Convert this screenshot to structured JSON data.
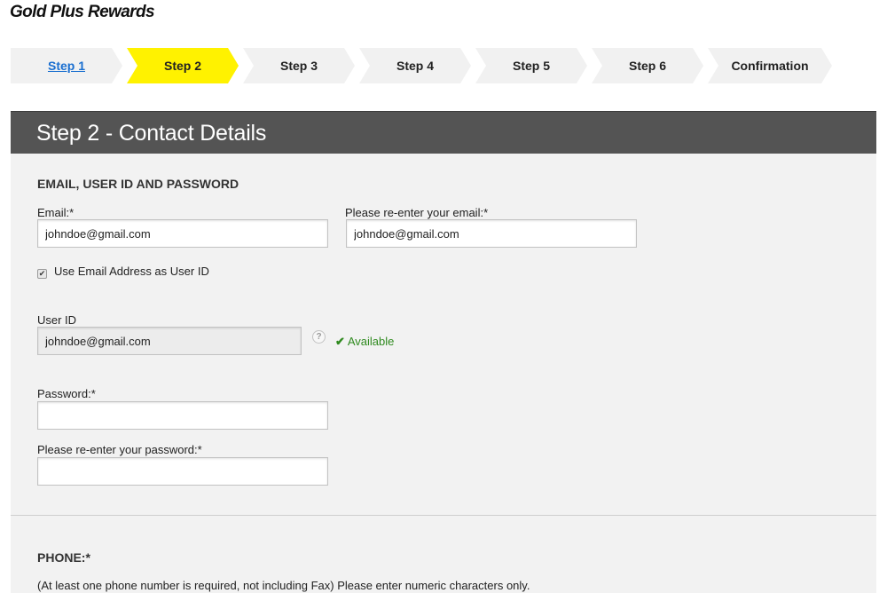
{
  "brand": {
    "title": "Gold Plus Rewards"
  },
  "steps": [
    {
      "label": "Step 1",
      "state": "link"
    },
    {
      "label": "Step 2",
      "state": "active"
    },
    {
      "label": "Step 3",
      "state": "inactive"
    },
    {
      "label": "Step 4",
      "state": "inactive"
    },
    {
      "label": "Step 5",
      "state": "inactive"
    },
    {
      "label": "Step 6",
      "state": "inactive"
    },
    {
      "label": "Confirmation",
      "state": "inactive"
    }
  ],
  "panel": {
    "title": "Step 2 - Contact Details"
  },
  "account": {
    "section_title": "EMAIL, USER ID AND PASSWORD",
    "email_label": "Email:*",
    "email_value": "johndoe@gmail.com",
    "email_confirm_label": "Please re-enter your email:*",
    "email_confirm_value": "johndoe@gmail.com",
    "use_email_label": "Use Email Address as User ID",
    "use_email_checked": true,
    "userid_label": "User ID",
    "userid_value": "johndoe@gmail.com",
    "availability_text": "Available",
    "password_label": "Password:*",
    "password_value": "",
    "password_confirm_label": "Please re-enter your password:*",
    "password_confirm_value": ""
  },
  "phone": {
    "section_title": "PHONE:*",
    "note": "(At least one phone number is required, not including Fax) Please enter numeric characters only."
  },
  "colors": {
    "active_step": "#fff200",
    "header_bg": "#545454",
    "panel_bg": "#f2f2f2",
    "available": "#2f8a1f",
    "link": "#1a6fd0"
  },
  "icons": {
    "help": "question-mark-icon",
    "check": "checkmark-icon"
  }
}
